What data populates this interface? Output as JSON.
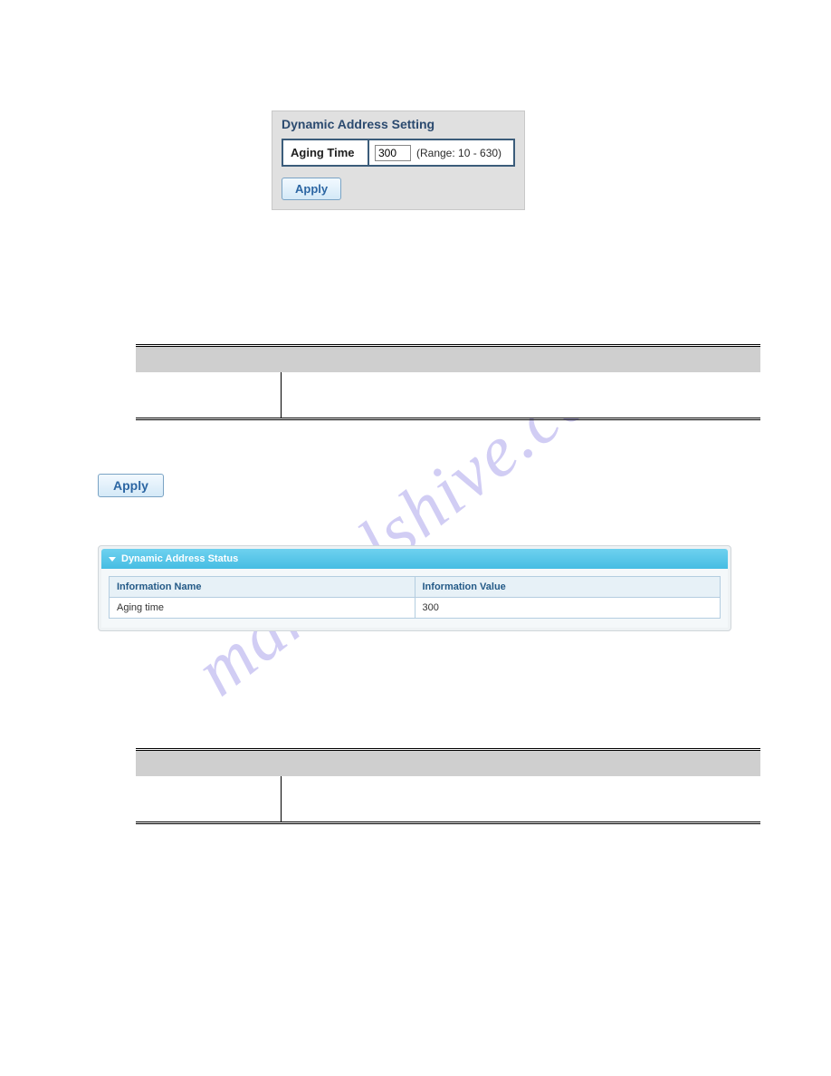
{
  "settings_panel": {
    "title": "Dynamic Address Setting",
    "row_label": "Aging Time",
    "input_value": "300",
    "range_hint": "(Range: 10 - 630)",
    "apply_label": "Apply"
  },
  "standalone_apply_label": "Apply",
  "status_panel": {
    "header": "Dynamic Address Status",
    "col1_header": "Information Name",
    "col2_header": "Information Value",
    "row1_name": "Aging time",
    "row1_value": "300"
  },
  "watermark": "manualshive.com"
}
